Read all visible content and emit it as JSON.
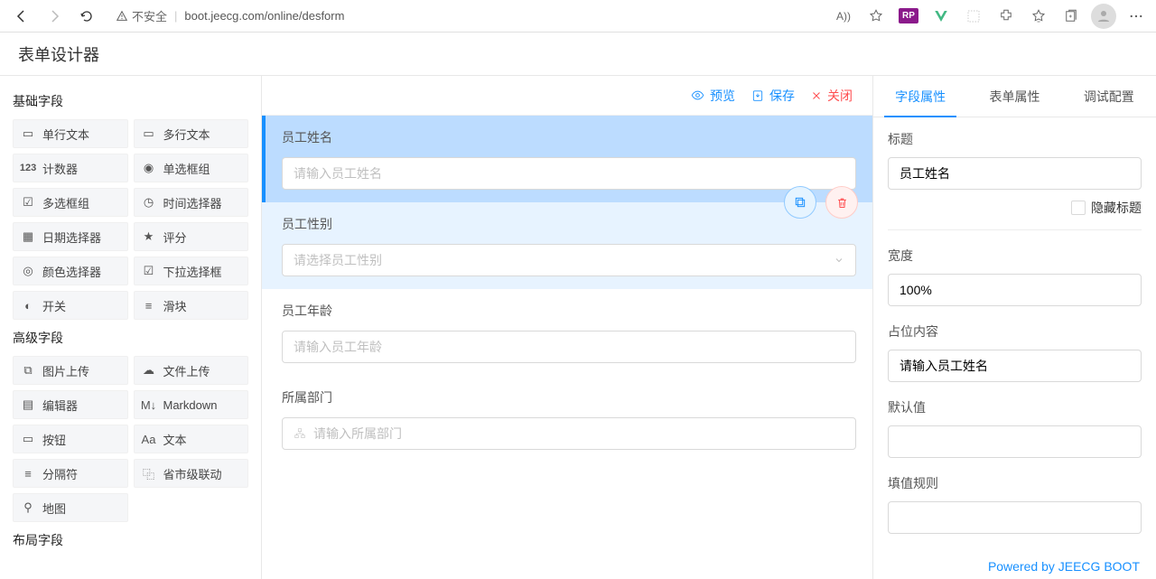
{
  "browser": {
    "insecure_label": "不安全",
    "url": "boot.jeecg.com/online/desform",
    "read_aloud": "A))"
  },
  "app": {
    "title": "表单设计器"
  },
  "sections": {
    "basic": "基础字段",
    "advanced": "高级字段",
    "layout": "布局字段"
  },
  "basic_components": [
    {
      "label": "单行文本",
      "icon": "▭"
    },
    {
      "label": "多行文本",
      "icon": "▭"
    },
    {
      "label": "计数器",
      "icon": "123"
    },
    {
      "label": "单选框组",
      "icon": "◉"
    },
    {
      "label": "多选框组",
      "icon": "☑"
    },
    {
      "label": "时间选择器",
      "icon": "◷"
    },
    {
      "label": "日期选择器",
      "icon": "▦"
    },
    {
      "label": "评分",
      "icon": "★"
    },
    {
      "label": "颜色选择器",
      "icon": "◎"
    },
    {
      "label": "下拉选择框",
      "icon": "☑"
    },
    {
      "label": "开关",
      "icon": "◐"
    },
    {
      "label": "滑块",
      "icon": "≡"
    }
  ],
  "advanced_components": [
    {
      "label": "图片上传",
      "icon": "⧉"
    },
    {
      "label": "文件上传",
      "icon": "☁"
    },
    {
      "label": "编辑器",
      "icon": "▤"
    },
    {
      "label": "Markdown",
      "icon": "M↓"
    },
    {
      "label": "按钮",
      "icon": "▭"
    },
    {
      "label": "文本",
      "icon": "Aa"
    },
    {
      "label": "分隔符",
      "icon": "≡"
    },
    {
      "label": "省市级联动",
      "icon": "⿻"
    },
    {
      "label": "地图",
      "icon": "⚲"
    }
  ],
  "toolbar": {
    "preview": "预览",
    "save": "保存",
    "close": "关闭"
  },
  "fields": [
    {
      "label": "员工姓名",
      "placeholder": "请输入员工姓名",
      "type": "input",
      "selected": true
    },
    {
      "label": "员工性别",
      "placeholder": "请选择员工性别",
      "type": "select",
      "related": true
    },
    {
      "label": "员工年龄",
      "placeholder": "请输入员工年龄",
      "type": "input"
    },
    {
      "label": "所属部门",
      "placeholder": "请输入所属部门",
      "type": "dept"
    }
  ],
  "prop_tabs": [
    "字段属性",
    "表单属性",
    "调试配置"
  ],
  "props": {
    "title_label": "标题",
    "title_value": "员工姓名",
    "hide_title_label": "隐藏标题",
    "width_label": "宽度",
    "width_value": "100%",
    "placeholder_label": "占位内容",
    "placeholder_value": "请输入员工姓名",
    "default_label": "默认值",
    "default_value": "",
    "fill_rule_label": "填值规则",
    "fill_rule_value": ""
  },
  "footer": "Powered by JEECG BOOT"
}
